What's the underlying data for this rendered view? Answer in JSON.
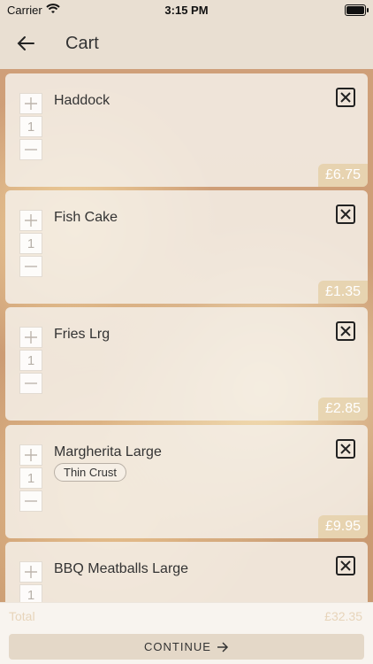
{
  "status": {
    "carrier": "Carrier",
    "time": "3:15 PM"
  },
  "nav": {
    "title": "Cart"
  },
  "items": [
    {
      "name": "Haddock",
      "qty": "1",
      "price": "£6.75"
    },
    {
      "name": "Fish Cake",
      "qty": "1",
      "price": "£1.35"
    },
    {
      "name": "Fries Lrg",
      "qty": "1",
      "price": "£2.85"
    },
    {
      "name": "Margherita Large",
      "option": "Thin Crust",
      "qty": "1",
      "price": "£9.95"
    },
    {
      "name": "BBQ Meatballs Large",
      "qty": "1",
      "price": ""
    }
  ],
  "total": {
    "label": "Total",
    "value": "£32.35"
  },
  "continue_label": "CONTINUE"
}
